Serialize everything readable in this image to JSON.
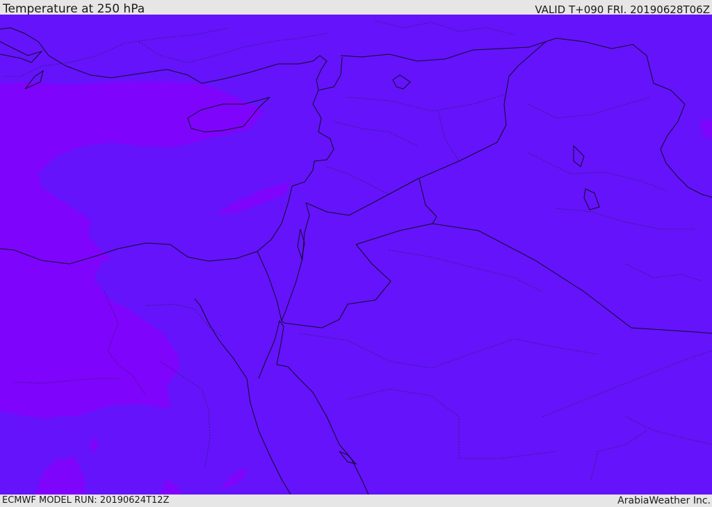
{
  "header": {
    "title": "Temperature at 250 hPa",
    "valid_time": "VALID T+090 FRI. 20190628T06Z"
  },
  "footer": {
    "model_run": "ECMWF MODEL RUN: 20190624T12Z",
    "provider": "ArabiaWeather Inc."
  },
  "map": {
    "field_colors": {
      "warmer_band": "#7f04fb",
      "base": "#6513fa"
    }
  }
}
